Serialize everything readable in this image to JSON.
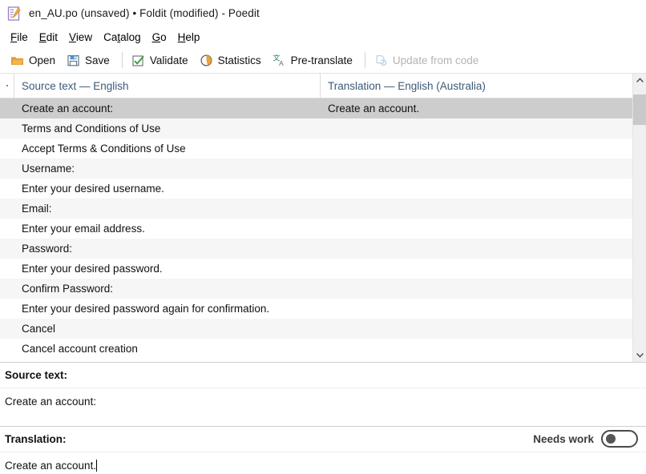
{
  "window": {
    "title": "en_AU.po (unsaved) • Foldit (modified) - Poedit",
    "icon": "poedit-document-pencil-icon"
  },
  "menubar": {
    "items": [
      {
        "label": "File",
        "mnemonic": "F",
        "rest": "ile"
      },
      {
        "label": "Edit",
        "mnemonic": "E",
        "rest": "dit"
      },
      {
        "label": "View",
        "mnemonic": "V",
        "rest": "iew"
      },
      {
        "label": "Catalog",
        "mnemonic": "t",
        "pre": "Ca",
        "rest": "alog"
      },
      {
        "label": "Go",
        "mnemonic": "G",
        "rest": "o"
      },
      {
        "label": "Help",
        "mnemonic": "H",
        "rest": "elp"
      }
    ]
  },
  "toolbar": {
    "open_label": "Open",
    "save_label": "Save",
    "validate_label": "Validate",
    "statistics_label": "Statistics",
    "pretranslate_label": "Pre-translate",
    "update_from_code_label": "Update from code",
    "update_from_code_disabled": true
  },
  "list": {
    "headers": {
      "marker": "",
      "source": "Source text — English",
      "translation": "Translation — English (Australia)"
    },
    "rows": [
      {
        "source": "Create an account:",
        "translation": "Create an account.",
        "selected": true
      },
      {
        "source": "Terms and Conditions of Use",
        "translation": "",
        "selected": false
      },
      {
        "source": "Accept Terms & Conditions of Use",
        "translation": "",
        "selected": false
      },
      {
        "source": "Username:",
        "translation": "",
        "selected": false
      },
      {
        "source": "Enter your desired username.",
        "translation": "",
        "selected": false
      },
      {
        "source": "Email:",
        "translation": "",
        "selected": false
      },
      {
        "source": "Enter your email address.",
        "translation": "",
        "selected": false
      },
      {
        "source": "Password:",
        "translation": "",
        "selected": false
      },
      {
        "source": "Enter your desired password.",
        "translation": "",
        "selected": false
      },
      {
        "source": "Confirm Password:",
        "translation": "",
        "selected": false
      },
      {
        "source": "Enter your desired password again for confirmation.",
        "translation": "",
        "selected": false
      },
      {
        "source": "Cancel",
        "translation": "",
        "selected": false
      },
      {
        "source": "Cancel account creation",
        "translation": "",
        "selected": false
      }
    ]
  },
  "source_pane": {
    "label": "Source text:",
    "value": "Create an account:"
  },
  "translation_pane": {
    "label": "Translation:",
    "needs_work_label": "Needs work",
    "needs_work_on": false,
    "value": "Create an account."
  },
  "colors": {
    "header_text": "#3c5a78",
    "selection": "#cdcdcd",
    "row_alt": "#f6f6f6",
    "folder_orange": "#e8a33d",
    "save_blue": "#4b93d1",
    "validate_green": "#3f9a3f",
    "stats_orange": "#e8a33d",
    "pretranslate_green": "#1f7a4d",
    "disabled_grey": "#b4b4b4"
  }
}
